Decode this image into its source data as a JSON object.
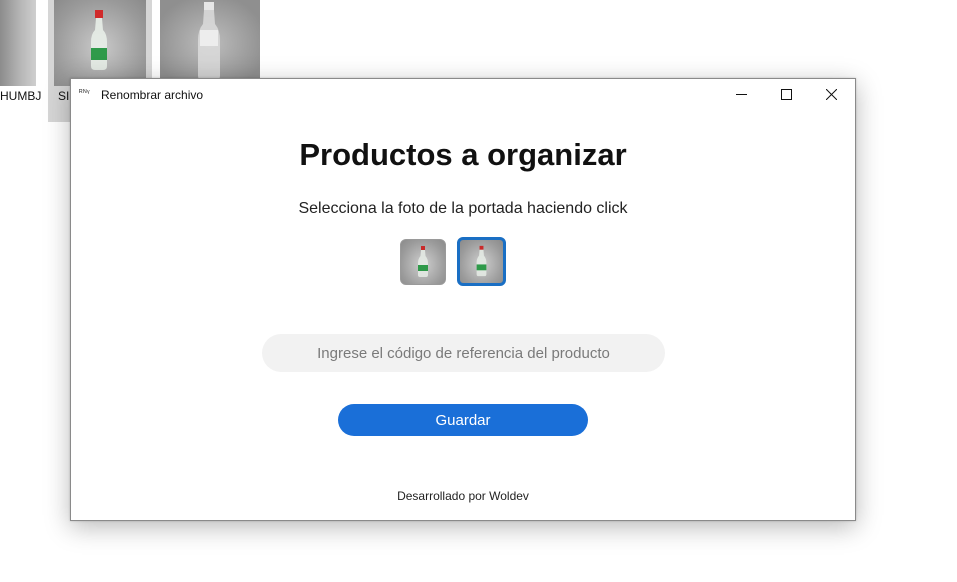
{
  "background": {
    "thumbnail_labels": [
      "HUMBJ",
      "SIN"
    ]
  },
  "window": {
    "app_icon": "ᴿᴺᵞ",
    "title": "Renombrar archivo",
    "controls": {
      "minimize": "—",
      "maximize": "☐",
      "close": "✕"
    }
  },
  "main": {
    "heading": "Productos a organizar",
    "subtitle": "Selecciona la foto de la portada haciendo click",
    "photos": [
      {
        "name": "bottle-photo",
        "selected": false
      },
      {
        "name": "bottle-photo",
        "selected": true
      }
    ],
    "reference_input": {
      "value": "",
      "placeholder": "Ingrese el código de referencia del producto"
    },
    "save_label": "Guardar",
    "footer": "Desarrollado por Woldev"
  },
  "colors": {
    "accent": "#1a6fd8",
    "selected_border": "#1a6fc4",
    "input_bg": "#f2f2f2"
  }
}
